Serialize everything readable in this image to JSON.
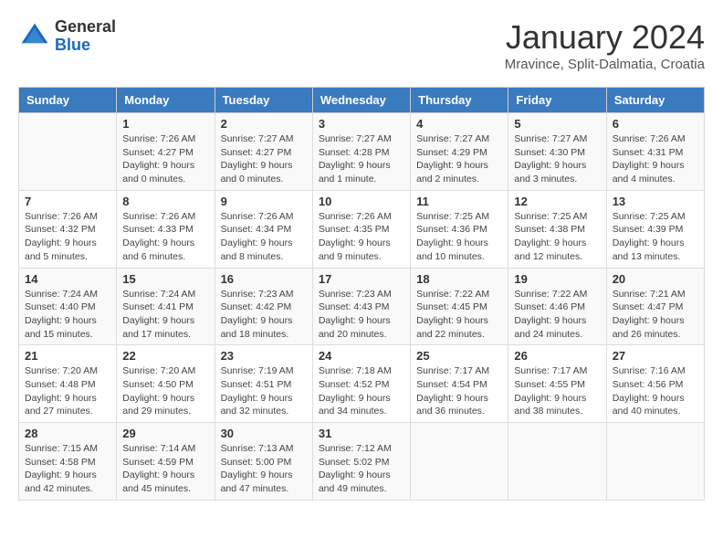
{
  "header": {
    "logo_general": "General",
    "logo_blue": "Blue",
    "month_title": "January 2024",
    "location": "Mravince, Split-Dalmatia, Croatia"
  },
  "days_of_week": [
    "Sunday",
    "Monday",
    "Tuesday",
    "Wednesday",
    "Thursday",
    "Friday",
    "Saturday"
  ],
  "weeks": [
    [
      {
        "day": "",
        "info": ""
      },
      {
        "day": "1",
        "info": "Sunrise: 7:26 AM\nSunset: 4:27 PM\nDaylight: 9 hours\nand 0 minutes."
      },
      {
        "day": "2",
        "info": "Sunrise: 7:27 AM\nSunset: 4:27 PM\nDaylight: 9 hours\nand 0 minutes."
      },
      {
        "day": "3",
        "info": "Sunrise: 7:27 AM\nSunset: 4:28 PM\nDaylight: 9 hours\nand 1 minute."
      },
      {
        "day": "4",
        "info": "Sunrise: 7:27 AM\nSunset: 4:29 PM\nDaylight: 9 hours\nand 2 minutes."
      },
      {
        "day": "5",
        "info": "Sunrise: 7:27 AM\nSunset: 4:30 PM\nDaylight: 9 hours\nand 3 minutes."
      },
      {
        "day": "6",
        "info": "Sunrise: 7:26 AM\nSunset: 4:31 PM\nDaylight: 9 hours\nand 4 minutes."
      }
    ],
    [
      {
        "day": "7",
        "info": "Sunrise: 7:26 AM\nSunset: 4:32 PM\nDaylight: 9 hours\nand 5 minutes."
      },
      {
        "day": "8",
        "info": "Sunrise: 7:26 AM\nSunset: 4:33 PM\nDaylight: 9 hours\nand 6 minutes."
      },
      {
        "day": "9",
        "info": "Sunrise: 7:26 AM\nSunset: 4:34 PM\nDaylight: 9 hours\nand 8 minutes."
      },
      {
        "day": "10",
        "info": "Sunrise: 7:26 AM\nSunset: 4:35 PM\nDaylight: 9 hours\nand 9 minutes."
      },
      {
        "day": "11",
        "info": "Sunrise: 7:25 AM\nSunset: 4:36 PM\nDaylight: 9 hours\nand 10 minutes."
      },
      {
        "day": "12",
        "info": "Sunrise: 7:25 AM\nSunset: 4:38 PM\nDaylight: 9 hours\nand 12 minutes."
      },
      {
        "day": "13",
        "info": "Sunrise: 7:25 AM\nSunset: 4:39 PM\nDaylight: 9 hours\nand 13 minutes."
      }
    ],
    [
      {
        "day": "14",
        "info": "Sunrise: 7:24 AM\nSunset: 4:40 PM\nDaylight: 9 hours\nand 15 minutes."
      },
      {
        "day": "15",
        "info": "Sunrise: 7:24 AM\nSunset: 4:41 PM\nDaylight: 9 hours\nand 17 minutes."
      },
      {
        "day": "16",
        "info": "Sunrise: 7:23 AM\nSunset: 4:42 PM\nDaylight: 9 hours\nand 18 minutes."
      },
      {
        "day": "17",
        "info": "Sunrise: 7:23 AM\nSunset: 4:43 PM\nDaylight: 9 hours\nand 20 minutes."
      },
      {
        "day": "18",
        "info": "Sunrise: 7:22 AM\nSunset: 4:45 PM\nDaylight: 9 hours\nand 22 minutes."
      },
      {
        "day": "19",
        "info": "Sunrise: 7:22 AM\nSunset: 4:46 PM\nDaylight: 9 hours\nand 24 minutes."
      },
      {
        "day": "20",
        "info": "Sunrise: 7:21 AM\nSunset: 4:47 PM\nDaylight: 9 hours\nand 26 minutes."
      }
    ],
    [
      {
        "day": "21",
        "info": "Sunrise: 7:20 AM\nSunset: 4:48 PM\nDaylight: 9 hours\nand 27 minutes."
      },
      {
        "day": "22",
        "info": "Sunrise: 7:20 AM\nSunset: 4:50 PM\nDaylight: 9 hours\nand 29 minutes."
      },
      {
        "day": "23",
        "info": "Sunrise: 7:19 AM\nSunset: 4:51 PM\nDaylight: 9 hours\nand 32 minutes."
      },
      {
        "day": "24",
        "info": "Sunrise: 7:18 AM\nSunset: 4:52 PM\nDaylight: 9 hours\nand 34 minutes."
      },
      {
        "day": "25",
        "info": "Sunrise: 7:17 AM\nSunset: 4:54 PM\nDaylight: 9 hours\nand 36 minutes."
      },
      {
        "day": "26",
        "info": "Sunrise: 7:17 AM\nSunset: 4:55 PM\nDaylight: 9 hours\nand 38 minutes."
      },
      {
        "day": "27",
        "info": "Sunrise: 7:16 AM\nSunset: 4:56 PM\nDaylight: 9 hours\nand 40 minutes."
      }
    ],
    [
      {
        "day": "28",
        "info": "Sunrise: 7:15 AM\nSunset: 4:58 PM\nDaylight: 9 hours\nand 42 minutes."
      },
      {
        "day": "29",
        "info": "Sunrise: 7:14 AM\nSunset: 4:59 PM\nDaylight: 9 hours\nand 45 minutes."
      },
      {
        "day": "30",
        "info": "Sunrise: 7:13 AM\nSunset: 5:00 PM\nDaylight: 9 hours\nand 47 minutes."
      },
      {
        "day": "31",
        "info": "Sunrise: 7:12 AM\nSunset: 5:02 PM\nDaylight: 9 hours\nand 49 minutes."
      },
      {
        "day": "",
        "info": ""
      },
      {
        "day": "",
        "info": ""
      },
      {
        "day": "",
        "info": ""
      }
    ]
  ]
}
